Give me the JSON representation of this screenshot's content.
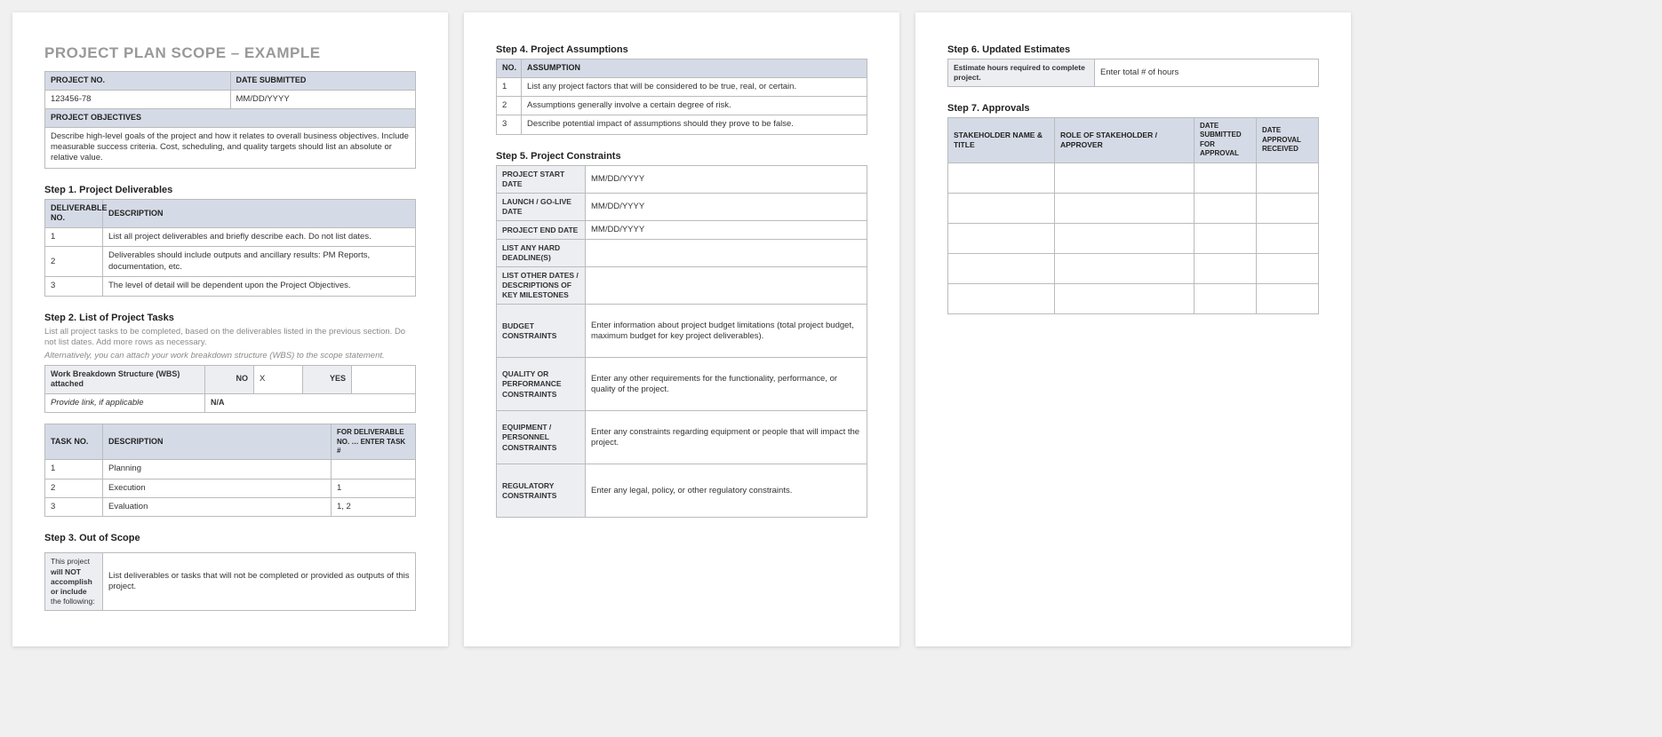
{
  "title": "PROJECT PLAN SCOPE – EXAMPLE",
  "projectInfo": {
    "projectNoLabel": "PROJECT NO.",
    "projectNo": "123456-78",
    "dateSubmittedLabel": "DATE SUBMITTED",
    "dateSubmitted": "MM/DD/YYYY",
    "objectivesLabel": "PROJECT OBJECTIVES",
    "objectives": "Describe high-level goals of the project and how it relates to overall business objectives.  Include measurable success criteria.  Cost, scheduling, and quality targets should list an absolute or relative value."
  },
  "step1": {
    "heading": "Step 1. Project Deliverables",
    "colNo": "DELIVERABLE NO.",
    "colDesc": "DESCRIPTION",
    "rows": [
      {
        "no": "1",
        "desc": "List all project deliverables and briefly describe each. Do not list dates."
      },
      {
        "no": "2",
        "desc": "Deliverables should include outputs and ancillary results: PM Reports, documentation, etc."
      },
      {
        "no": "3",
        "desc": "The level of detail will be dependent upon the Project Objectives."
      }
    ]
  },
  "step2": {
    "heading": "Step 2. List of Project Tasks",
    "sub1": "List all project tasks to be completed, based on the deliverables listed in the previous section. Do not list dates. Add more rows as necessary.",
    "sub2": "Alternatively, you can attach your work breakdown structure (WBS) to the scope statement.",
    "wbsLabel": "Work Breakdown Structure (WBS) attached",
    "noLabel": "NO",
    "noVal": "X",
    "yesLabel": "YES",
    "yesVal": "",
    "linkLabel": "Provide link, if applicable",
    "linkVal": "N/A",
    "tasks": {
      "colNo": "TASK NO.",
      "colDesc": "DESCRIPTION",
      "colFor": "FOR DELIVERABLE NO. … ENTER TASK #",
      "rows": [
        {
          "no": "1",
          "desc": "Planning",
          "for": ""
        },
        {
          "no": "2",
          "desc": "Execution",
          "for": "1"
        },
        {
          "no": "3",
          "desc": "Evaluation",
          "for": "1, 2"
        }
      ]
    }
  },
  "step3": {
    "heading": "Step 3. Out of Scope",
    "labelPre": "This project ",
    "labelBold": "will NOT accomplish or include",
    "labelPost": " the following:",
    "body": "List deliverables or tasks that will not be completed or provided as outputs of this project."
  },
  "step4": {
    "heading": "Step 4. Project Assumptions",
    "colNo": "NO.",
    "colAssump": "ASSUMPTION",
    "rows": [
      {
        "no": "1",
        "d": "List any project factors that will be considered to be true, real, or certain."
      },
      {
        "no": "2",
        "d": "Assumptions generally involve a certain degree of risk."
      },
      {
        "no": "3",
        "d": "Describe potential impact of assumptions should they prove to be false."
      }
    ]
  },
  "step5": {
    "heading": "Step 5. Project Constraints",
    "projectStartLabel": "PROJECT START DATE",
    "projectStart": "MM/DD/YYYY",
    "goLiveLabel": "LAUNCH / GO-LIVE DATE",
    "goLive": "MM/DD/YYYY",
    "projectEndLabel": "PROJECT END DATE",
    "projectEnd": "MM/DD/YYYY",
    "hardDeadlineLabel": "LIST ANY HARD DEADLINE(S)",
    "hardDeadline": "",
    "otherDatesLabel": "LIST OTHER DATES / DESCRIPTIONS OF KEY MILESTONES",
    "otherDates": "",
    "budgetLabel": "BUDGET CONSTRAINTS",
    "budget": "Enter information about project budget limitations (total project budget, maximum budget for key project deliverables).",
    "qualityLabel": "QUALITY OR PERFORMANCE CONSTRAINTS",
    "quality": "Enter any other requirements for the functionality, performance, or quality of the project.",
    "equipLabel": "EQUIPMENT / PERSONNEL CONSTRAINTS",
    "equip": "Enter any constraints regarding equipment or people that will impact the project.",
    "regLabel": "REGULATORY CONSTRAINTS",
    "reg": "Enter any legal, policy, or other regulatory constraints."
  },
  "step6": {
    "heading": "Step 6. Updated Estimates",
    "label": "Estimate hours required to complete project.",
    "value": "Enter total # of hours"
  },
  "step7": {
    "heading": "Step 7. Approvals",
    "colName": "STAKEHOLDER NAME & TITLE",
    "colRole": "ROLE OF STAKEHOLDER / APPROVER",
    "colSub": "DATE SUBMITTED FOR APPROVAL",
    "colRec": "DATE APPROVAL RECEIVED"
  }
}
